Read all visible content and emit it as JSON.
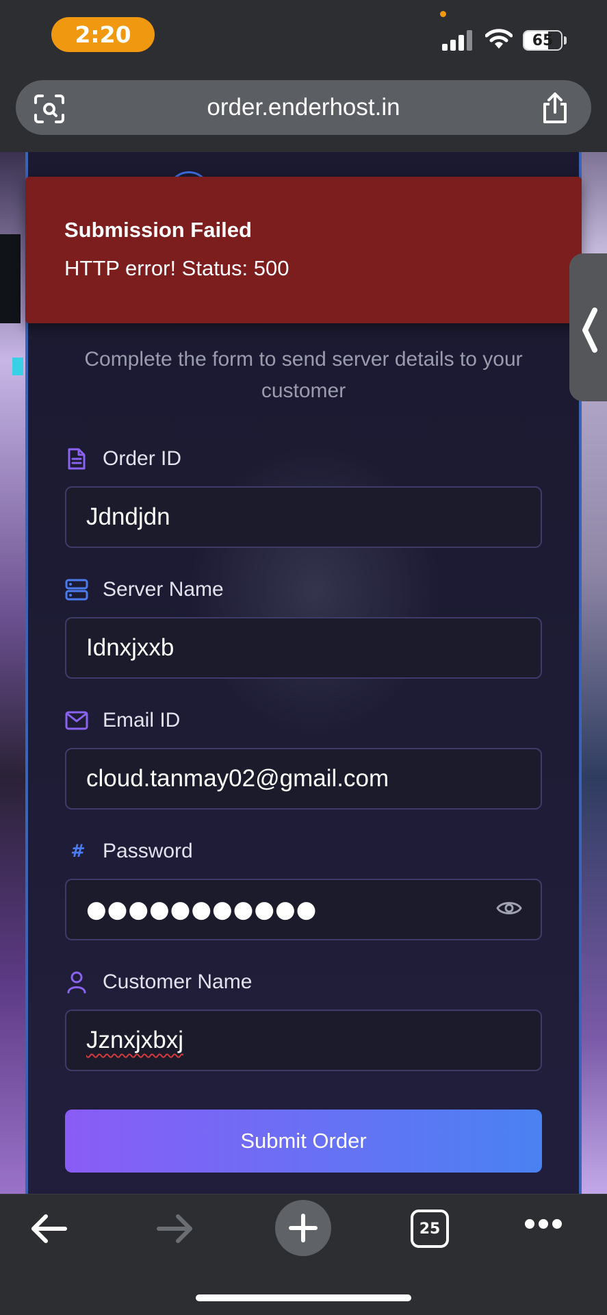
{
  "status_bar": {
    "time": "2:20",
    "battery_level": "65",
    "battery_fraction": 0.65,
    "colors": {
      "time_pill": "#f0980f"
    }
  },
  "browser": {
    "url": "order.enderhost.in",
    "tab_count": "25",
    "icons": {
      "scan": "scan-icon",
      "share": "share-icon",
      "back": "back-arrow-icon",
      "forward": "forward-arrow-icon",
      "new_tab": "plus-icon",
      "tabs": "tabs-icon",
      "more": "more-icon"
    }
  },
  "toast": {
    "title": "Submission Failed",
    "message": "HTTP error! Status: 500",
    "color": "#7c1d1e"
  },
  "form": {
    "subtitle": "Complete the form to send server details to your customer",
    "fields": [
      {
        "label": "Order ID",
        "value": "Jdndjdn",
        "icon": "document-icon"
      },
      {
        "label": "Server Name",
        "value": "Idnxjxxb",
        "icon": "server-icon"
      },
      {
        "label": "Email ID",
        "value": "cloud.tanmay02@gmail.com",
        "icon": "mail-icon"
      },
      {
        "label": "Password",
        "value": "●●●●●●●●●●●",
        "icon": "hash-icon",
        "hash_glyph": "#"
      },
      {
        "label": "Customer Name",
        "value": "Jznxjxbxj",
        "icon": "user-icon"
      }
    ],
    "submit_label": "Submit Order",
    "colors": {
      "accent_start": "#8a5cf6",
      "accent_end": "#4a82f2",
      "icon_purple": "#8a63f0",
      "icon_blue": "#4a7cf0"
    }
  }
}
